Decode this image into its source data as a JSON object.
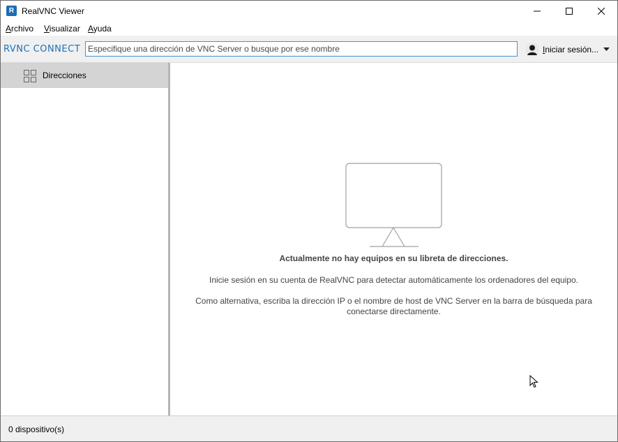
{
  "window": {
    "title": "RealVNC Viewer",
    "app_icon_letter": "R"
  },
  "menu": {
    "items": [
      "Archivo",
      "Visualizar",
      "Ayuda"
    ]
  },
  "toolbar": {
    "logo_text": "RVNC CONNECT",
    "search_placeholder": "Especifique una dirección de VNC Server o busque por ese nombre",
    "signin_label": "Iniciar sesión..."
  },
  "sidebar": {
    "items": [
      {
        "label": "Direcciones",
        "icon": "grid-icon",
        "selected": true
      }
    ]
  },
  "main": {
    "empty_title": "Actualmente no hay equipos en su libreta de direcciones.",
    "empty_line1": "Inicie sesión en su cuenta de RealVNC para detectar automáticamente los ordenadores del equipo.",
    "empty_line2": "Como alternativa, escriba la dirección IP o el nombre de host de VNC Server en la barra de búsqueda para conectarse directamente."
  },
  "status": {
    "text": "0 dispositivo(s)"
  },
  "colors": {
    "accent": "#1f6fb8",
    "selected_bg": "#d4d4d4",
    "toolbar_bg": "#f0f0f0"
  }
}
